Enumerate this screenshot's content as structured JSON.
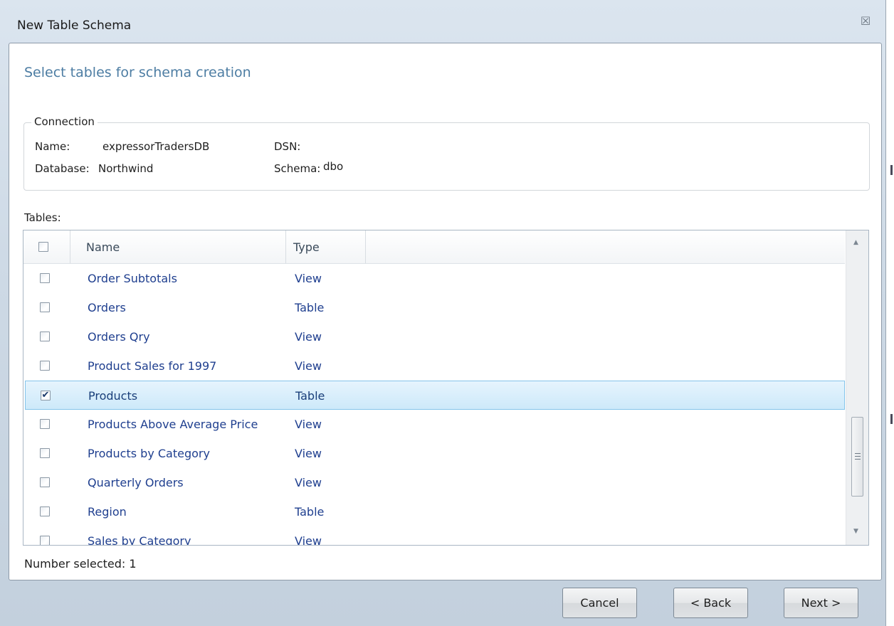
{
  "window": {
    "title": "New Table Schema",
    "close_glyph": "☒"
  },
  "page": {
    "heading": "Select tables for schema creation"
  },
  "connection": {
    "legend": "Connection",
    "name_label": "Name:",
    "name_value": "expressorTradersDB",
    "dsn_label": "DSN:",
    "dsn_value": "",
    "database_label": "Database:",
    "database_value": "Northwind",
    "schema_label": "Schema:",
    "schema_value": "dbo"
  },
  "tables": {
    "label": "Tables:",
    "columns": [
      "Name",
      "Type"
    ],
    "rows": [
      {
        "name": "Order Subtotals",
        "type": "View",
        "checked": false
      },
      {
        "name": "Orders",
        "type": "Table",
        "checked": false
      },
      {
        "name": "Orders Qry",
        "type": "View",
        "checked": false
      },
      {
        "name": "Product Sales for 1997",
        "type": "View",
        "checked": false
      },
      {
        "name": "Products",
        "type": "Table",
        "checked": true
      },
      {
        "name": "Products Above Average Price",
        "type": "View",
        "checked": false
      },
      {
        "name": "Products by Category",
        "type": "View",
        "checked": false
      },
      {
        "name": "Quarterly Orders",
        "type": "View",
        "checked": false
      },
      {
        "name": "Region",
        "type": "Table",
        "checked": false
      },
      {
        "name": "Sales by Category",
        "type": "View",
        "checked": false
      }
    ]
  },
  "footer": {
    "number_selected": "Number selected: 1"
  },
  "buttons": {
    "cancel": "Cancel",
    "back": "< Back",
    "next": "Next >"
  },
  "icons": {
    "checkmark": "✔",
    "scroll_up": "▲",
    "scroll_down": "▼"
  },
  "colors": {
    "accent": "#4d7da3",
    "link_text": "#1f3f8f",
    "selection": "#cde9fa"
  }
}
